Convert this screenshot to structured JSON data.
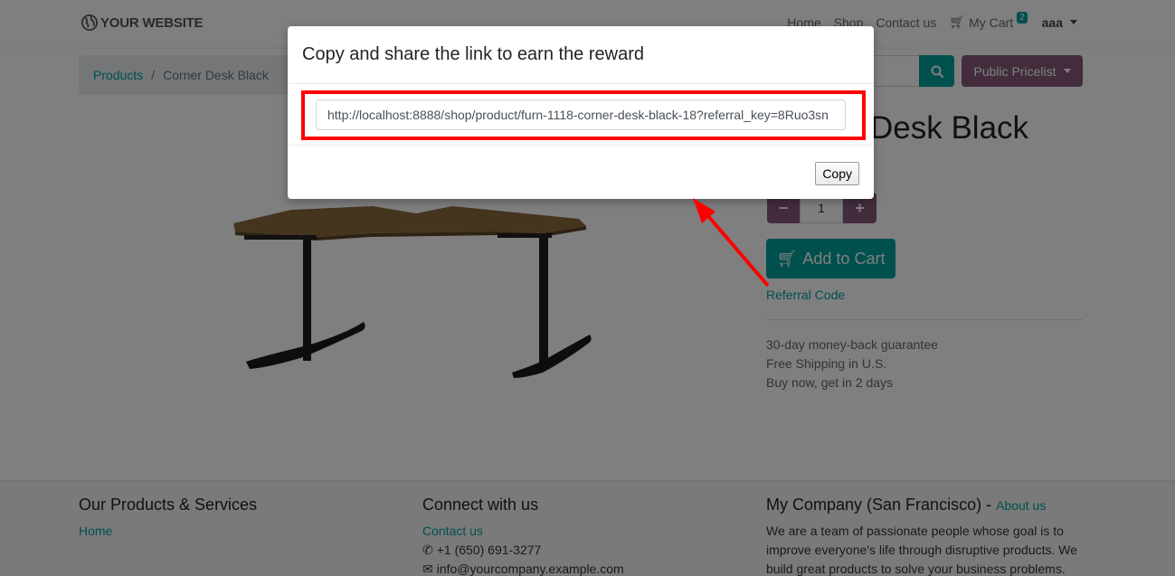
{
  "navbar": {
    "brand": "YOUR WEBSITE",
    "links": [
      "Home",
      "Shop",
      "Contact us"
    ],
    "cart_label": "My Cart",
    "cart_count": "2",
    "user": "aaa"
  },
  "breadcrumb": {
    "parent": "Products",
    "separator": "/",
    "current": "Corner Desk Black"
  },
  "pricelist_label": "Public Pricelist",
  "product": {
    "title_visible": "Desk Black",
    "quantity": "1",
    "minus": "−",
    "plus": "+",
    "add_to_cart": "Add to Cart",
    "referral_link": "Referral Code",
    "perks": [
      "30-day money-back guarantee",
      "Free Shipping in U.S.",
      "Buy now, get in 2 days"
    ]
  },
  "footer": {
    "col1": {
      "title": "Our Products & Services",
      "links": [
        "Home"
      ]
    },
    "col2": {
      "title": "Connect with us",
      "contact": "Contact us",
      "phone": "+1 (650) 691-3277",
      "email": "info@yourcompany.example.com"
    },
    "col3": {
      "title": "My Company (San Francisco)",
      "dash": " - ",
      "about": "About us",
      "lines": [
        "We are a team of passionate people whose goal is to",
        "improve everyone's life through disruptive products. We",
        "build great products to solve your business problems."
      ]
    }
  },
  "modal": {
    "title": "Copy and share the link to earn the reward",
    "link_value": "http://localhost:8888/shop/product/furn-1118-corner-desk-black-18?referral_key=8Ruo3sn",
    "copy_label": "Copy"
  },
  "colors": {
    "accent": "#00A09D",
    "secondary": "#875A7B",
    "annotation": "#FF0000"
  }
}
